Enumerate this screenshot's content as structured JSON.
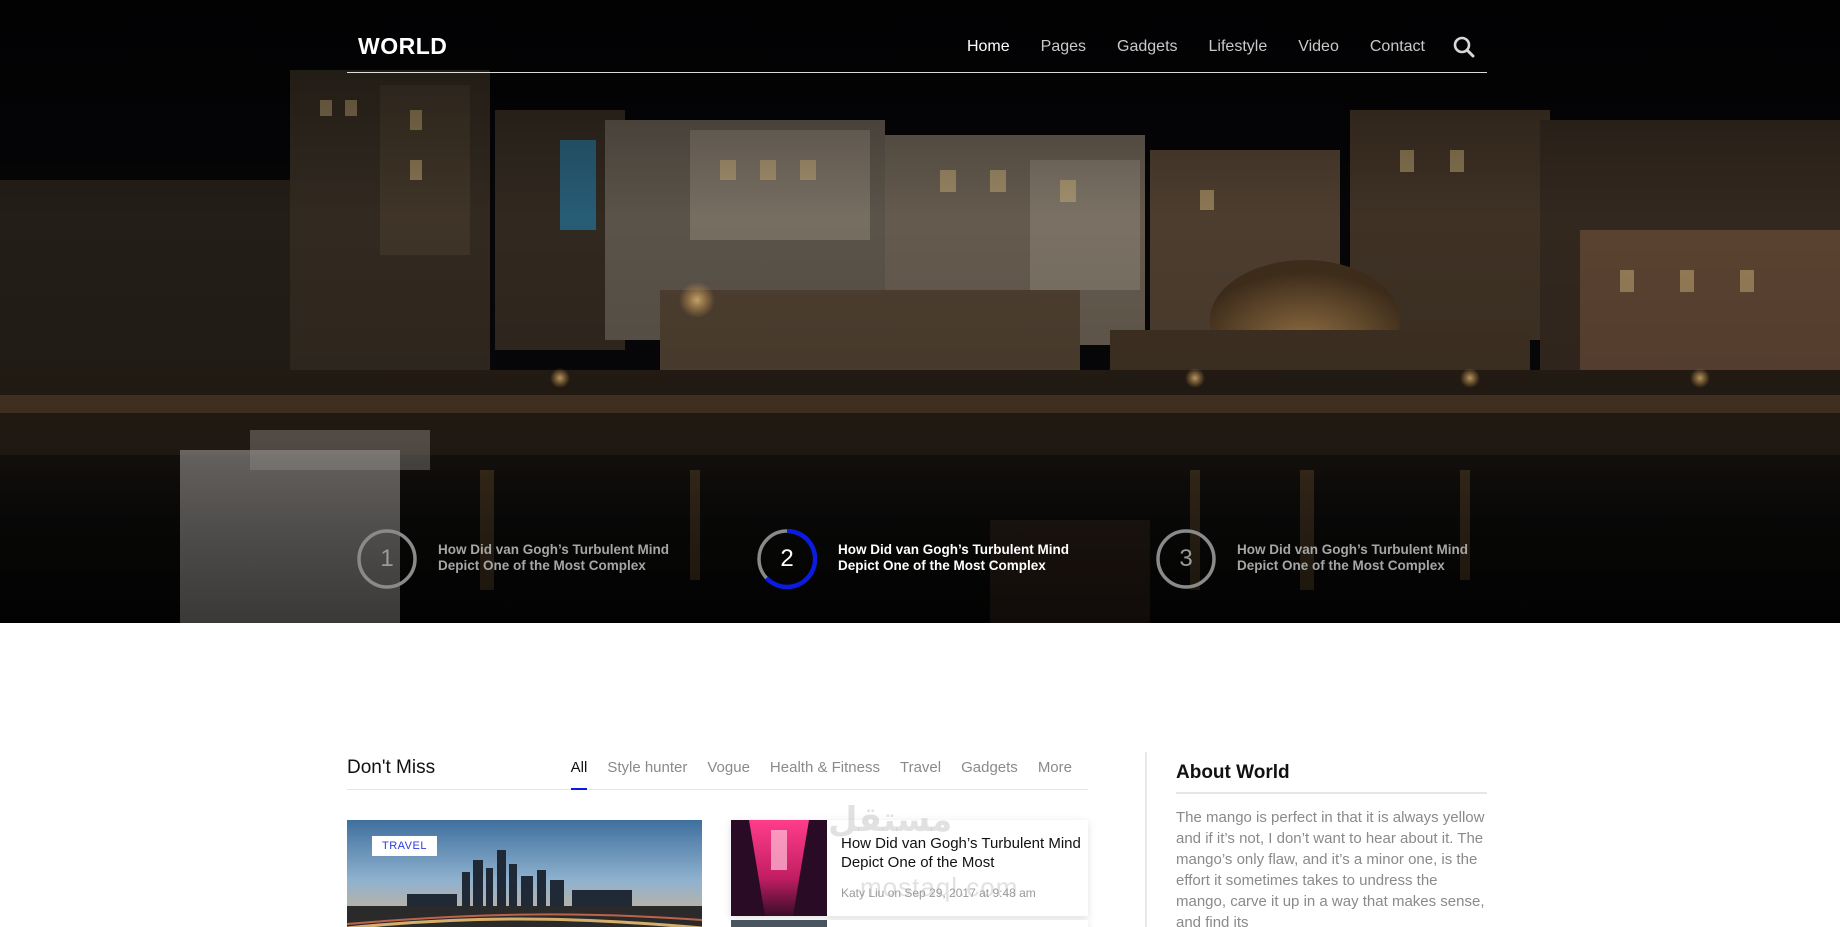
{
  "site": {
    "logo": "WORLD"
  },
  "nav": {
    "items": [
      {
        "label": "Home",
        "active": true
      },
      {
        "label": "Pages",
        "active": false
      },
      {
        "label": "Gadgets",
        "active": false
      },
      {
        "label": "Lifestyle",
        "active": false
      },
      {
        "label": "Video",
        "active": false
      },
      {
        "label": "Contact",
        "active": false
      }
    ],
    "search_icon": "search-icon"
  },
  "hero": {
    "slides": [
      {
        "number": "1",
        "title": "How Did van Gogh’s Turbulent Mind Depict One of the Most Complex",
        "active": false
      },
      {
        "number": "2",
        "title": "How Did van Gogh’s Turbulent Mind Depict One of the Most Complex",
        "active": true
      },
      {
        "number": "3",
        "title": "How Did van Gogh’s Turbulent Mind Depict One of the Most Complex",
        "active": false
      }
    ],
    "active_slide_color": "#0b1be0"
  },
  "dont_miss": {
    "title": "Don't Miss",
    "tabs": [
      {
        "label": "All",
        "active": true
      },
      {
        "label": "Style hunter",
        "active": false
      },
      {
        "label": "Vogue",
        "active": false
      },
      {
        "label": "Health & Fitness",
        "active": false
      },
      {
        "label": "Travel",
        "active": false
      },
      {
        "label": "Gadgets",
        "active": false
      },
      {
        "label": "More",
        "active": false
      }
    ],
    "feature": {
      "category": "TRAVEL"
    },
    "posts": [
      {
        "title": "How Did van Gogh’s Turbulent Mind Depict One of the Most",
        "meta": "Katy Liu on Sep 29, 2017 at 9:48 am"
      }
    ]
  },
  "about": {
    "title": "About World",
    "text": "The mango is perfect in that it is always yellow and if it’s not, I don’t want to hear about it. The mango’s only flaw, and it’s a minor one, is the effort it sometimes takes to undress the mango, carve it up in a way that makes sense, and find its"
  },
  "watermark": {
    "arabic": "مستقل",
    "latin": "mostaql.com"
  },
  "colors": {
    "accent": "#0b1be0",
    "badge_text": "#2e3be0"
  }
}
